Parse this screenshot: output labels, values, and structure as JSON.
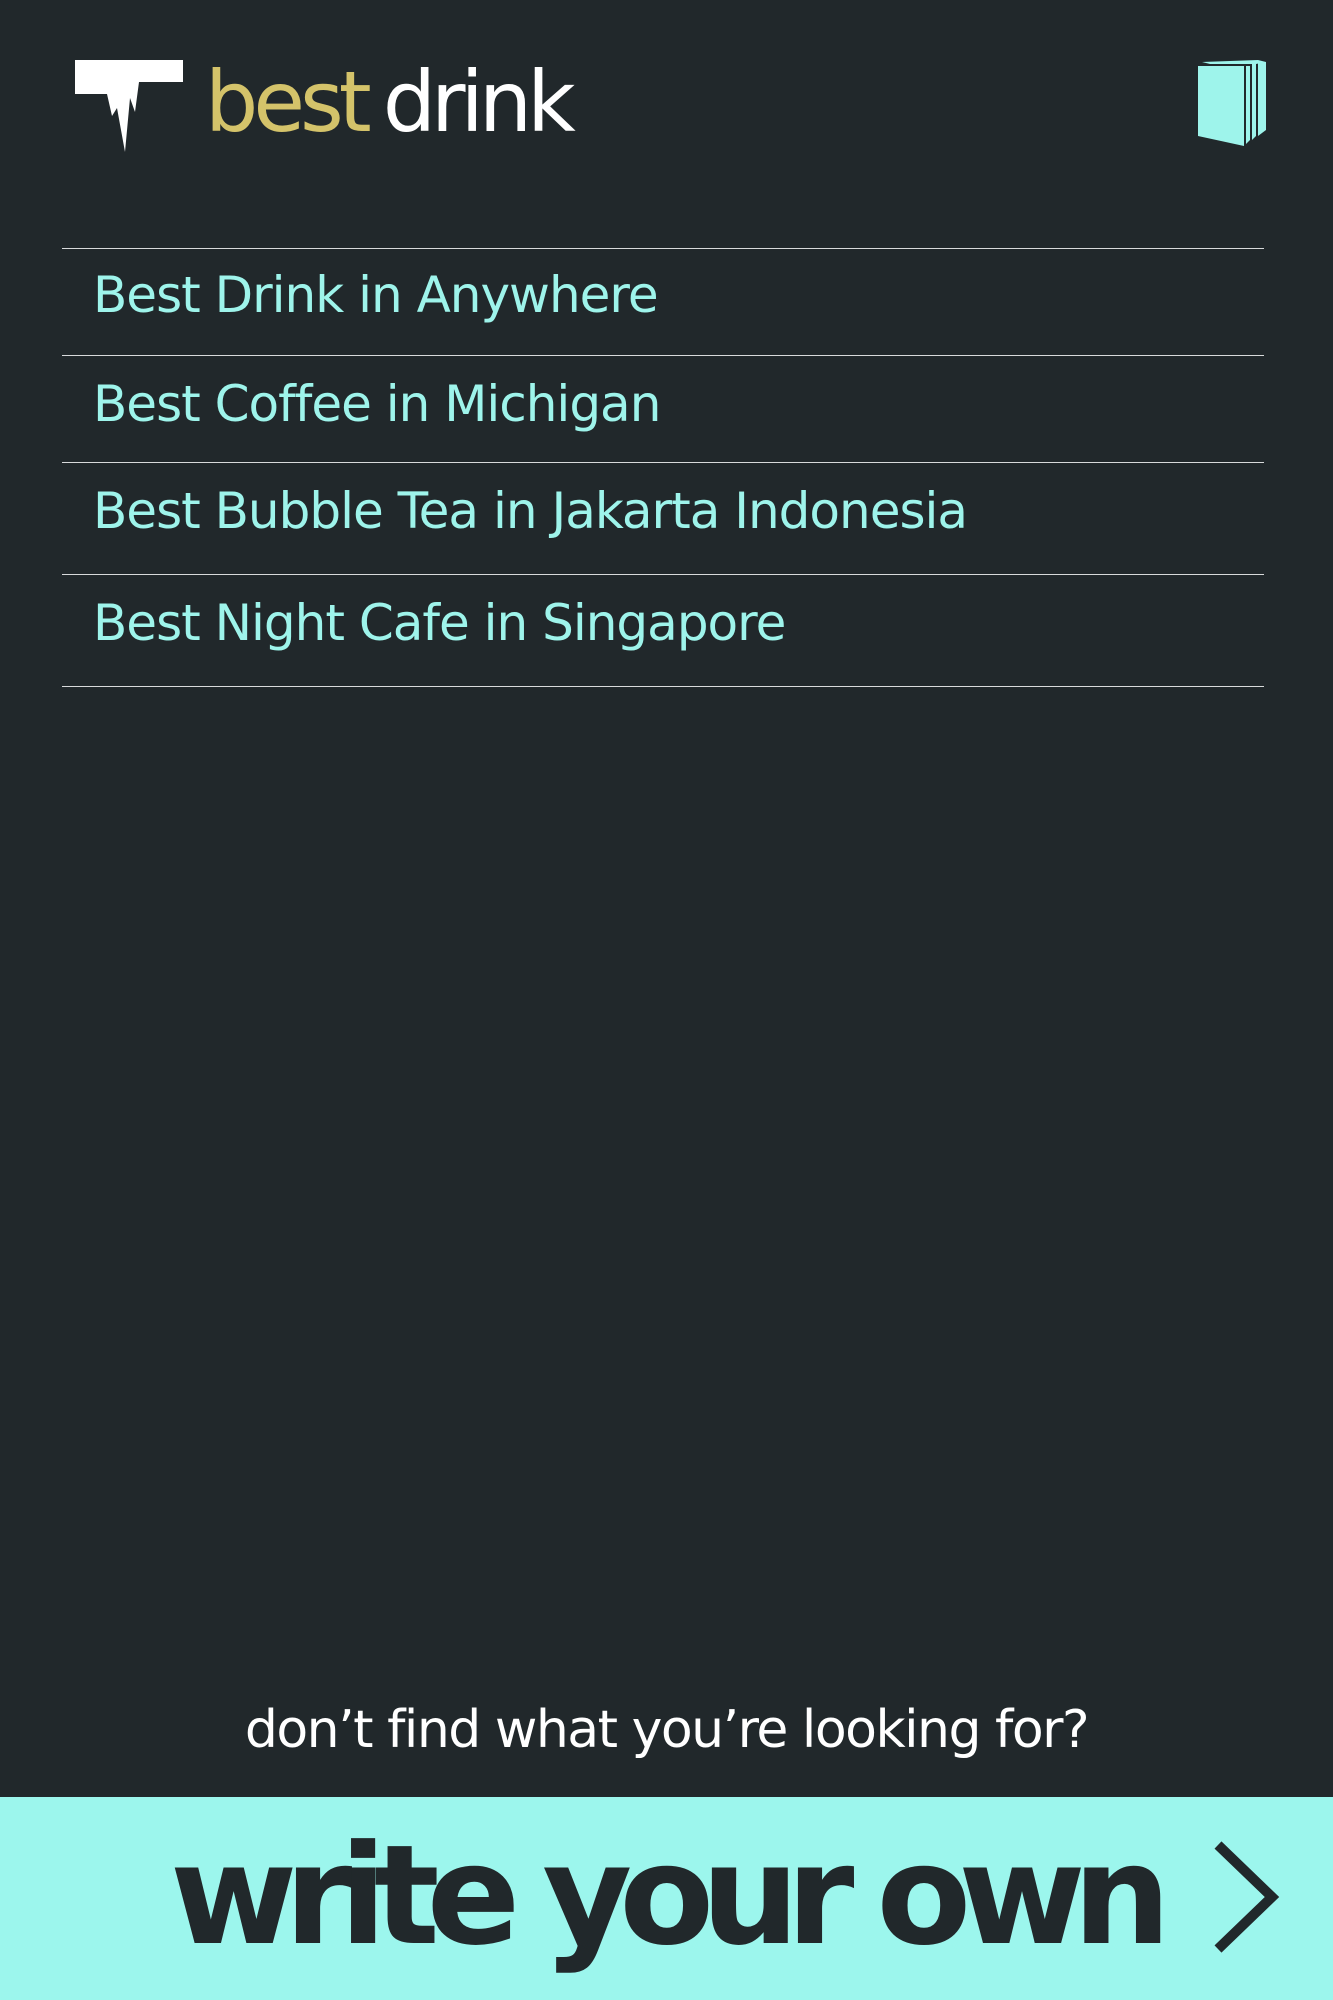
{
  "header": {
    "logo_icon": "bird-logo-icon",
    "brand_word_1": "best",
    "brand_word_2": "drink",
    "menu_icon": "book-menu-icon"
  },
  "list": {
    "items": [
      {
        "label": "Best Drink in Anywhere"
      },
      {
        "label": "Best Coffee in Michigan"
      },
      {
        "label": "Best Bubble Tea in Jakarta Indonesia"
      },
      {
        "label": "Best Night Cafe in Singapore"
      }
    ]
  },
  "footer": {
    "prompt": "don’t find what you’re looking for?",
    "cta_label": "write your own",
    "cta_icon": "chevron-right-icon"
  },
  "colors": {
    "background": "#21282b",
    "accent": "#9cf6ed",
    "brand_gold": "#d4c36a",
    "divider": "#d8dadb"
  }
}
